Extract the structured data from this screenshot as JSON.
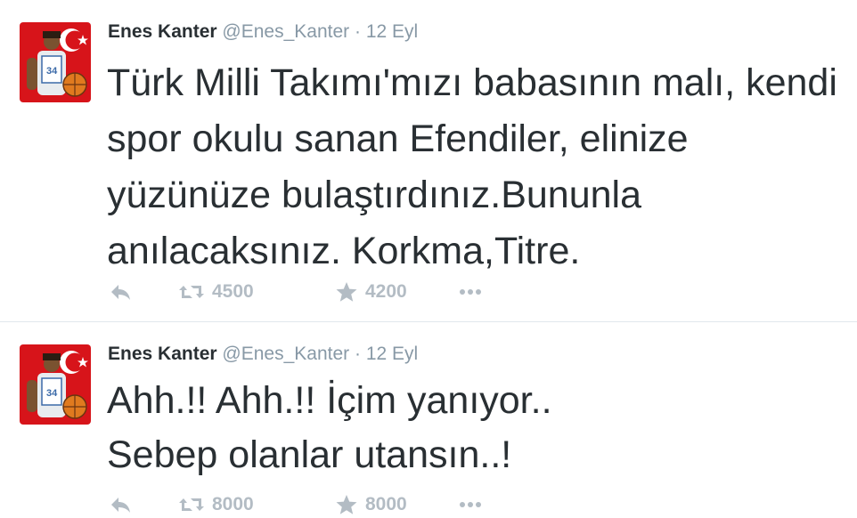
{
  "tweets": [
    {
      "fullname": "Enes Kanter",
      "username": "@Enes_Kanter",
      "separator": "·",
      "time": "12 Eyl",
      "text": "Türk Milli Takımı'mızı babasının malı, kendi\nspor okulu sanan Efendiler, elinize\nyüzünüze bulaştırdınız.Bununla\nanılacaksınız. Korkma,Titre.",
      "retweets": "4500",
      "favorites": "4200"
    },
    {
      "fullname": "Enes Kanter",
      "username": "@Enes_Kanter",
      "separator": "·",
      "time": "12 Eyl",
      "text": "Ahh.!! Ahh.!! İçim yanıyor..\nSebep olanlar utansın..!",
      "retweets": "8000",
      "favorites": "8000"
    }
  ],
  "colors": {
    "text": "#292f33",
    "muted": "#8899a6",
    "action": "#b3bcc4",
    "flag_red": "#d7141a"
  },
  "icons": [
    "reply-icon",
    "retweet-icon",
    "star-icon",
    "more-icon"
  ]
}
